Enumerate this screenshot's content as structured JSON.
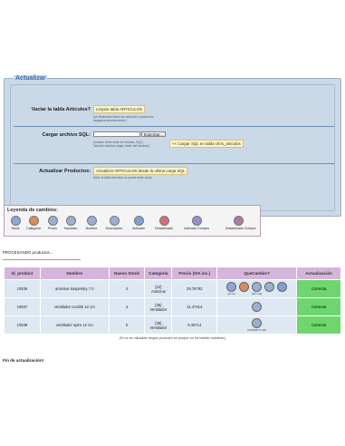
{
  "update_panel": {
    "title": "Actualizar",
    "vaciar": {
      "label": "Vaciar la tabla Artículos?",
      "button": "Limpiar tabla ARTICULOS",
      "note1": "(se eliminarán todos los artículos o productos",
      "note2": "cargados anteriormente.)"
    },
    "cargar": {
      "label": "Cargar archivo SQL:",
      "browse": "Examinar...",
      "button": "<< Cargar SQL en tabla chris_articulos",
      "note1": "(nombre debe estar en formato .SQL)",
      "note2": "Tamaño máximo según límite del servidor)"
    },
    "actualizar": {
      "label": "Actualizar Productos:",
      "button": "Actualizar ARTICULOS desde la ultima carga SQL",
      "note": "Nota: la tabla artículos no puede estar vacía"
    }
  },
  "legend": {
    "title": "Leyenda de cambios:",
    "items": [
      {
        "label": "Stock",
        "icon": "stock-icon",
        "color": "#8ea6d8"
      },
      {
        "label": "Categoría",
        "icon": "category-icon",
        "color": "#d98b5a"
      },
      {
        "label": "Precio",
        "icon": "price-icon",
        "color": "#9ab0d0"
      },
      {
        "label": "Impuesto",
        "icon": "tax-icon",
        "color": "#9ab0d0"
      },
      {
        "label": "Nombre",
        "icon": "name-icon",
        "color": "#9ab0d0"
      },
      {
        "label": "Descripcion",
        "icon": "description-icon",
        "color": "#9ab0d0"
      },
      {
        "label": "Activado",
        "icon": "activated-icon",
        "color": "#7ea0d4"
      },
      {
        "label": "Desactivado",
        "icon": "deactivated-icon",
        "color": "#d96a7a"
      },
      {
        "label": "Activado Compra",
        "icon": "purchase-activated-icon",
        "color": "#9a8ed0"
      },
      {
        "label": "Desactivado Compra",
        "icon": "purchase-deactivated-icon",
        "color": "#b07aa0"
      }
    ]
  },
  "processing_text": "PROCESANDO productos...",
  "table": {
    "headers": [
      "Id_product",
      "Nombre",
      "Nuevo Stock",
      "Categoría",
      "Precio (IVA inc.)",
      "QueCambio?",
      "Actualización"
    ],
    "rows": [
      {
        "id": "10536",
        "name": "antivirus kaspersky 7.0",
        "stock": "4",
        "cat_id": "[22]",
        "cat_name": "Antivirus",
        "price": "29.78792",
        "icon_caps": [
          "[4=>0]",
          "",
          "[22=>22]",
          ""
        ],
        "status": "Correcta"
      },
      {
        "id": "10537",
        "name": "ventilador coolink 12 cm",
        "stock": "4",
        "cat_id": "[35]",
        "cat_name": "Ventilador",
        "price": "11.47314",
        "icon_caps": [
          ""
        ],
        "status": "Correcta"
      },
      {
        "id": "10538",
        "name": "ventilador spire 12 cm",
        "stock": "0",
        "cat_id": "[35]",
        "cat_name": "Ventilador",
        "price": "9.46714",
        "icon_caps": [
          "[9.00000=>0.00]"
        ],
        "status": "Correcta"
      }
    ],
    "footer": "(Si no se visualiza ningún producto es porque no ha habido cambios.)"
  },
  "fin_text": "Fin de actualización!"
}
